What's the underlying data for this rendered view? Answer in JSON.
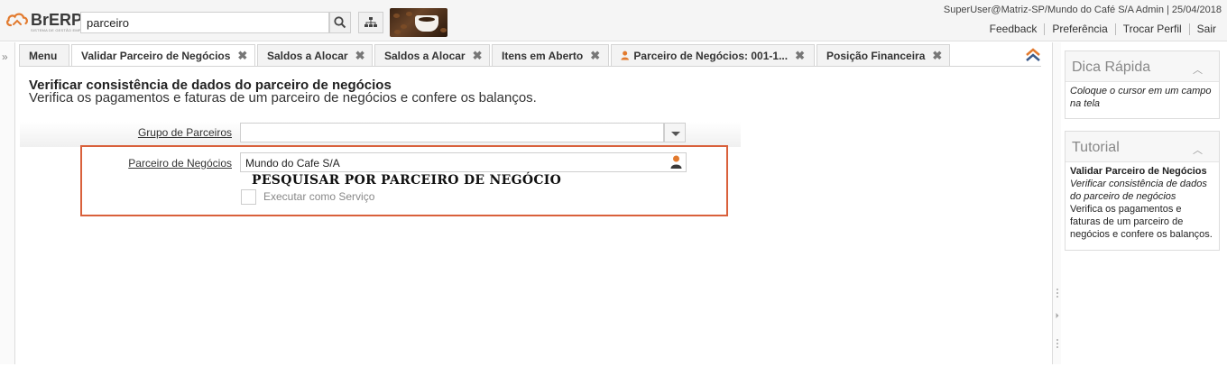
{
  "header": {
    "brand": "BrERP",
    "tagline": "SISTEMA DE GESTÃO EMPRESARIAL",
    "search_value": "parceiro",
    "user_info": "SuperUser@Matriz-SP/Mundo do Café S/A Admin | 25/04/2018",
    "links": [
      "Feedback",
      "Preferência",
      "Trocar Perfil",
      "Sair"
    ]
  },
  "tabs": [
    {
      "label": "Menu",
      "closable": false
    },
    {
      "label": "Validar Parceiro de Negócios",
      "closable": true,
      "active": true
    },
    {
      "label": "Saldos a Alocar",
      "closable": true
    },
    {
      "label": "Saldos a Alocar",
      "closable": true
    },
    {
      "label": "Itens em Aberto",
      "closable": true
    },
    {
      "label": "Parceiro de Negócios: 001-1...",
      "closable": true,
      "icon": "person-icon"
    },
    {
      "label": "Posição Financeira",
      "closable": true
    }
  ],
  "main": {
    "title": "Verificar consistência de dados do parceiro de negócios",
    "description": "Verifica os pagamentos e faturas de um parceiro de negócios e confere os balanços.",
    "fields": {
      "grupo_label": "Grupo de Parceiros",
      "grupo_value": "",
      "parceiro_label": "Parceiro de Negócios",
      "parceiro_value": "Mundo do Cafe S/A",
      "servico_label": "Executar como Serviço",
      "servico_checked": false
    },
    "annotation": "PESQUISAR POR PARCEIRO DE NEGÓCIO"
  },
  "right_panel": {
    "dica_title": "Dica Rápida",
    "dica_text": "Coloque o cursor em um campo na tela",
    "tutorial_title": "Tutorial",
    "tutorial_heading": "Validar Parceiro de Negócios",
    "tutorial_italic": "Verificar consistência de dados do parceiro de negócios",
    "tutorial_text": "Verifica os pagamentos e faturas de um parceiro de negócios e confere os balanços."
  },
  "colors": {
    "accent_orange": "#e27a2e",
    "highlight_border": "#d9603b"
  }
}
